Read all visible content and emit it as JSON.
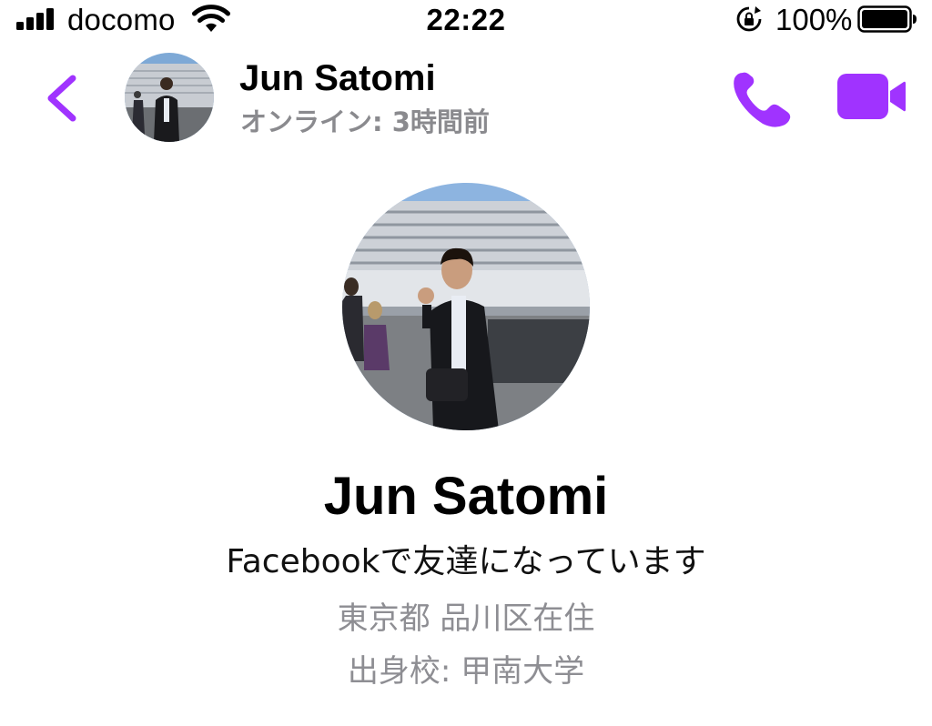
{
  "status_bar": {
    "carrier": "docomo",
    "time": "22:22",
    "battery_percent": "100%",
    "signal_icon": "cellular-signal-icon",
    "wifi_icon": "wifi-icon",
    "rotation_lock_icon": "rotation-lock-icon",
    "battery_icon": "battery-full-icon",
    "battery_level": 1.0
  },
  "header": {
    "back_icon": "chevron-left-icon",
    "name": "Jun Satomi",
    "status": "オンライン: 3時間前",
    "call_icon": "phone-icon",
    "video_icon": "video-camera-icon"
  },
  "profile": {
    "name": "Jun Satomi",
    "friend_status": "Facebookで友達になっています",
    "location": "東京都 品川区在住",
    "education": "出身校: 甲南大学"
  },
  "colors": {
    "accent": "#a033ff",
    "secondary_text": "#8e8e93",
    "background": "#ffffff"
  }
}
